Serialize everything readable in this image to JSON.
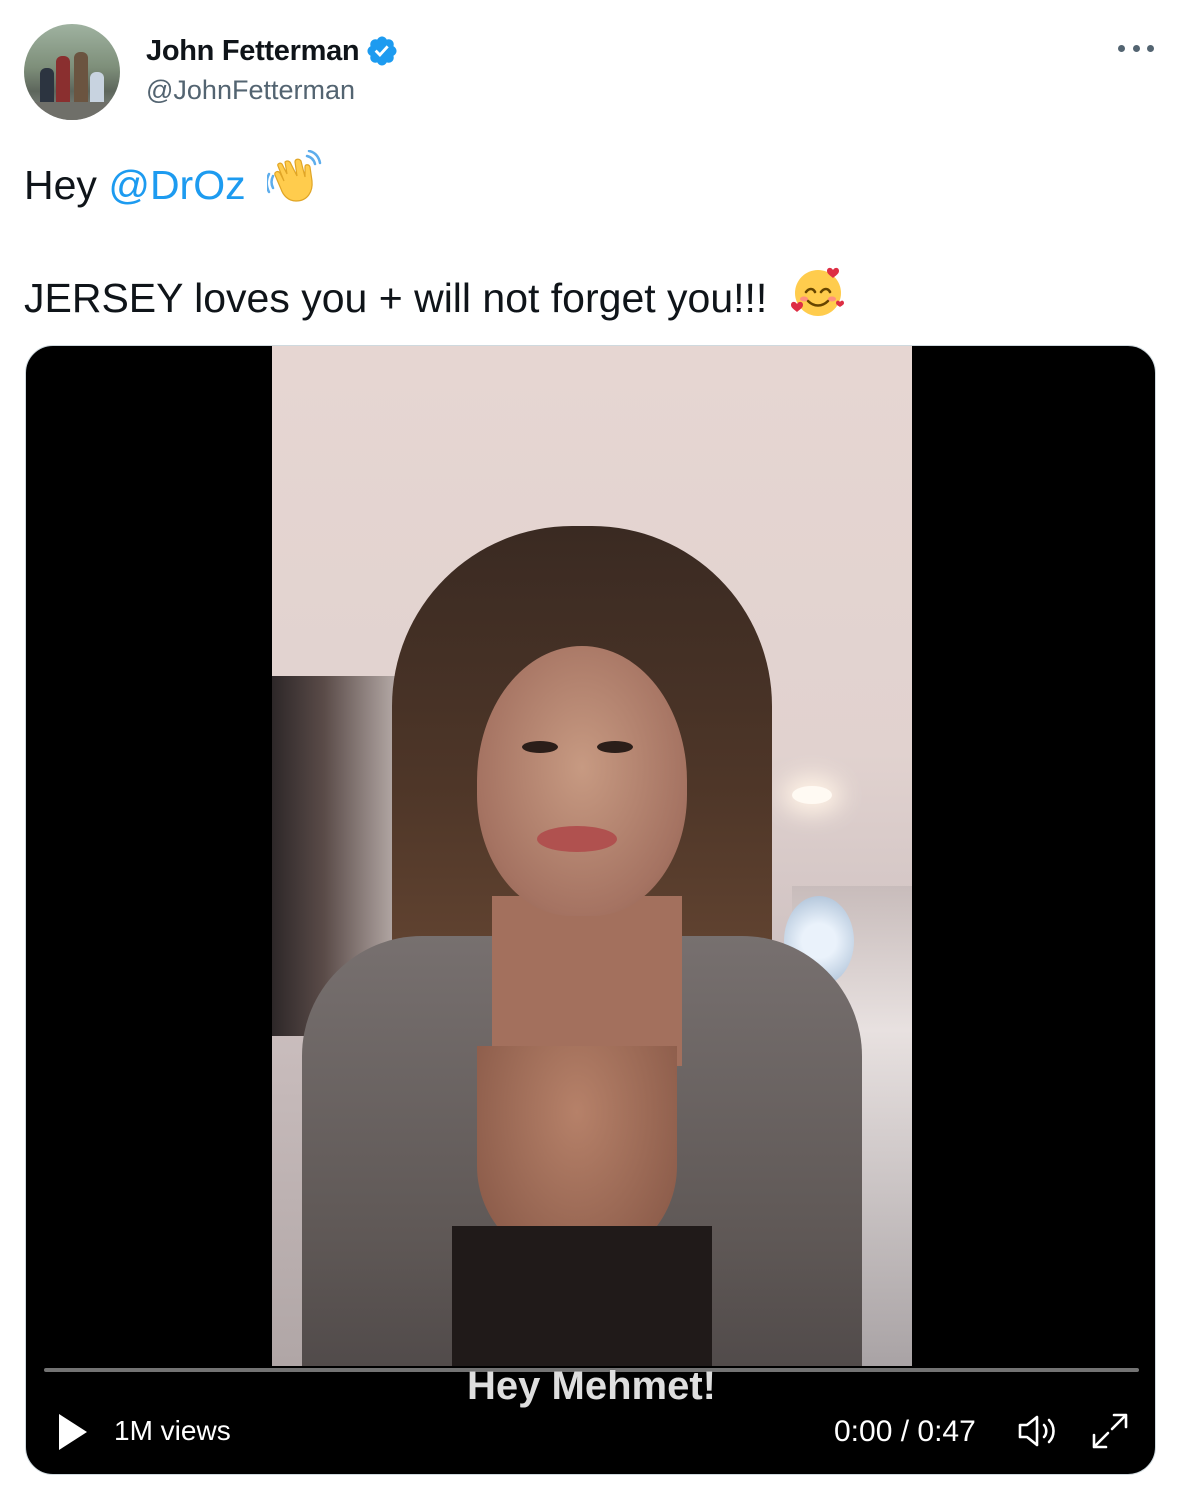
{
  "author": {
    "display_name": "John Fetterman",
    "handle": "@JohnFetterman",
    "verified": true,
    "avatar": "family-photo-avatar"
  },
  "tweet": {
    "line1_prefix": "Hey",
    "mention": "@DrOz",
    "line1_emoji": "waving-hand-emoji",
    "line2": "JERSEY loves you + will not forget you!!!",
    "line2_emoji": "smiling-face-with-hearts-emoji"
  },
  "video": {
    "subtitle": "Hey Mehmet!",
    "views": "1M views",
    "time": "0:00 / 0:47",
    "progress": 0.0
  },
  "colors": {
    "link": "#1d9bf0",
    "secondary_text": "#536471",
    "verified_badge": "#1d9bf0"
  }
}
